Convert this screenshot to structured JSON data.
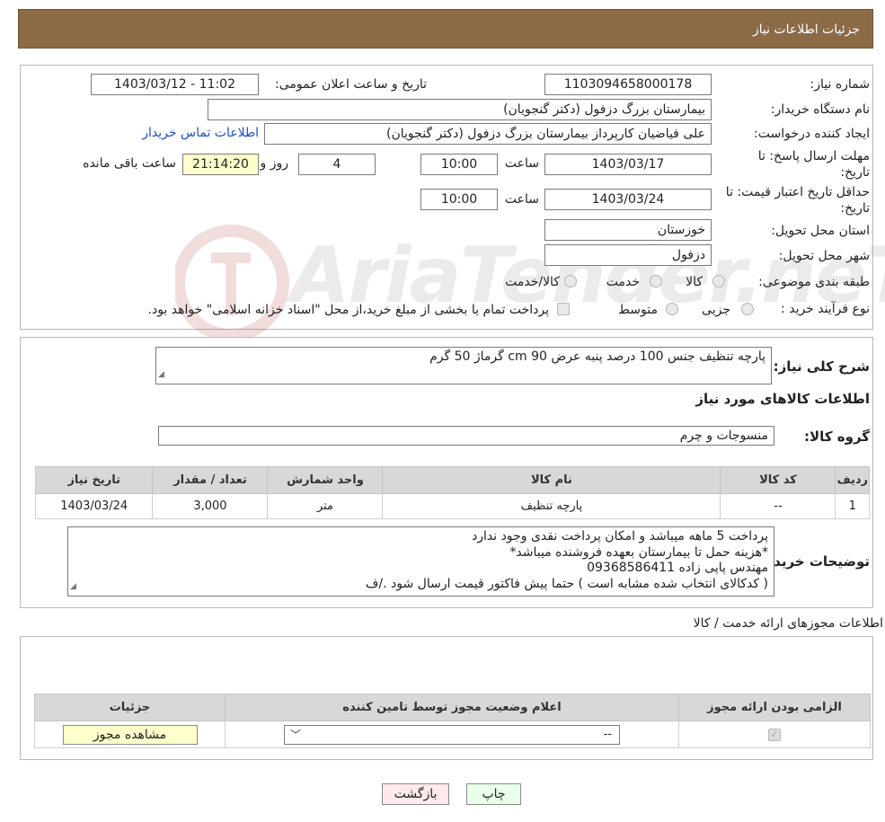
{
  "header": {
    "title": "جزئیات اطلاعات نیاز"
  },
  "form": {
    "need_number_label": "شماره نیاز:",
    "need_number": "1103094658000178",
    "announce_label": "تاریخ و ساعت اعلان عمومی:",
    "announce_value": "1403/03/12 - 11:02",
    "buyer_org_label": "نام دستگاه خریدار:",
    "buyer_org": "بیمارستان بزرگ دزفول (دکتر گنجویان)",
    "requester_label": "ایجاد کننده درخواست:",
    "requester": "علی فیاضیان کارپرداز بیمارستان بزرگ دزفول (دکتر گنجویان)",
    "contact_link": "اطلاعات تماس خریدار",
    "deadline_label_1": "مهلت ارسال پاسخ: تا",
    "deadline_label_2": "تاریخ:",
    "deadline_date": "1403/03/17",
    "time_label": "ساعت",
    "deadline_time": "10:00",
    "days_value": "4",
    "days_label": "روز و",
    "remaining_time": "21:14:20",
    "remaining_label": "ساعت باقی مانده",
    "validity_label_1": "حداقل تاریخ اعتبار قیمت: تا",
    "validity_label_2": "تاریخ:",
    "validity_date": "1403/03/24",
    "validity_time": "10:00",
    "province_label": "استان محل تحویل:",
    "province": "خوزستان",
    "city_label": "شهر محل تحویل:",
    "city": "دزفول",
    "category_label": "طبقه بندی موضوعی:",
    "category_options": [
      "کالا",
      "خدمت",
      "کالا/خدمت"
    ],
    "process_label": "نوع فرآیند خرید :",
    "process_options": [
      "جزیی",
      "متوسط"
    ],
    "process_note": "پرداخت تمام یا بخشی از مبلغ خرید،از محل \"اسناد خزانه اسلامی\" خواهد بود."
  },
  "description": {
    "label": "شرح کلی نیاز:",
    "value": "پارچه تنظیف جنس 100 درصد پنبه عرض 90 cm گرماژ 50 گرم"
  },
  "goods": {
    "section_title": "اطلاعات کالاهای مورد نیاز",
    "group_label": "گروه کالا:",
    "group_value": "منسوجات و چرم",
    "columns": [
      "ردیف",
      "کد کالا",
      "نام کالا",
      "واحد شمارش",
      "تعداد / مقدار",
      "تاریخ نیاز"
    ],
    "rows": [
      [
        "1",
        "--",
        "پارچه تنظیف",
        "متر",
        "3,000",
        "1403/03/24"
      ]
    ]
  },
  "buyer_notes": {
    "label": "توضیحات خریدار:",
    "lines": [
      "پرداخت 5 ماهه میباشد و امکان پرداخت نقدی وجود ندارد",
      "*هزینه حمل تا بیمارستان بعهده فروشنده میباشد*",
      "مهندس پاپی زاده 09368586411",
      "( کدکالای انتخاب شده مشابه است ) حتما پیش فاکتور قیمت ارسال شود ./ف"
    ]
  },
  "licenses": {
    "section_title": "اطلاعات مجوزهای ارائه خدمت / کالا",
    "columns": [
      "الزامی بودن ارائه مجوز",
      "اعلام وضعیت مجوز توسط تامین کننده",
      "جزئیات"
    ],
    "select_value": "--",
    "view_button": "مشاهده مجوز"
  },
  "footer": {
    "print_button": "چاپ",
    "back_button": "بازگشت"
  },
  "watermark": {
    "text": "AriaTender.neT"
  }
}
